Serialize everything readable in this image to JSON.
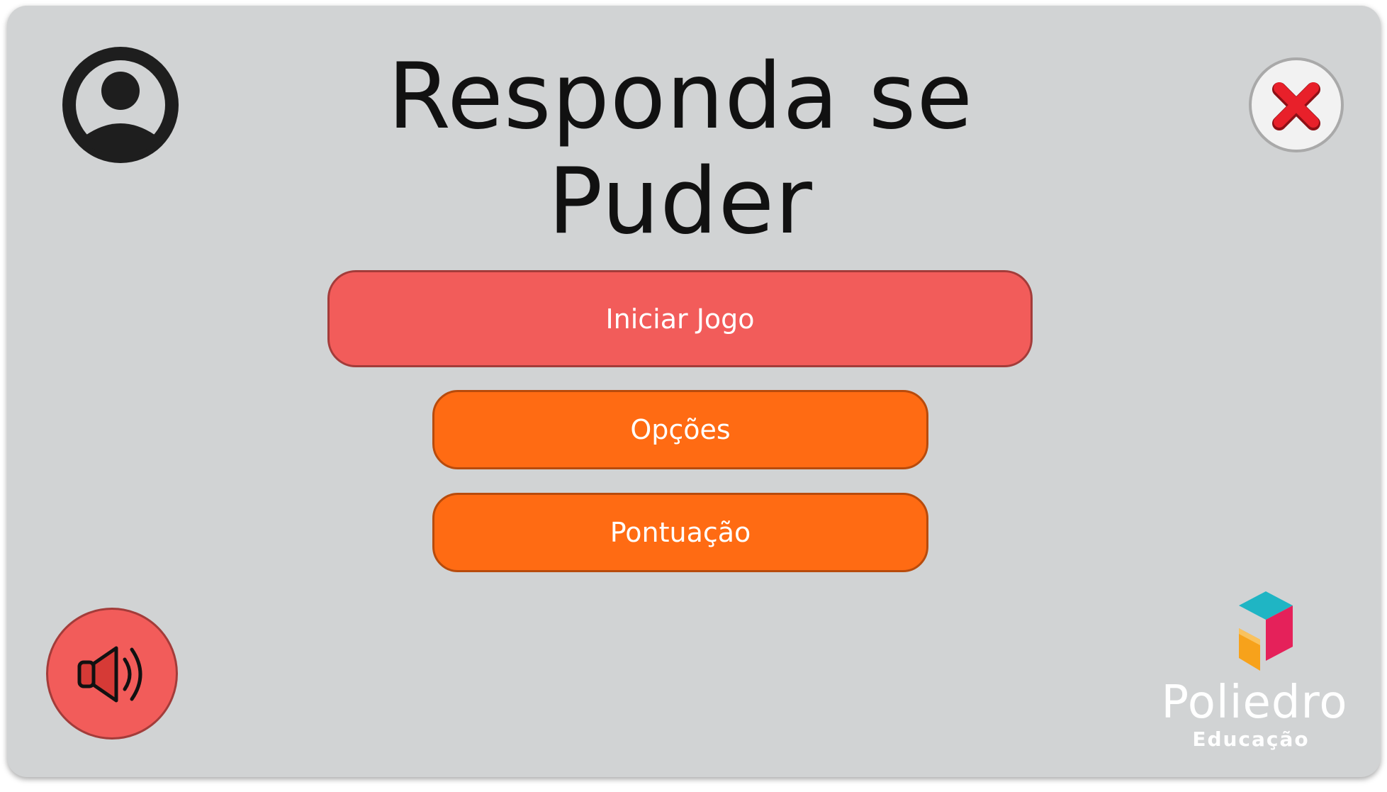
{
  "game": {
    "title_line1": "Responda se",
    "title_line2": "Puder"
  },
  "menu": {
    "start_label": "Iniciar Jogo",
    "options_label": "Opções",
    "score_label": "Pontuação"
  },
  "icons": {
    "profile": "user-circle-icon",
    "close": "red-x-icon",
    "sound": "speaker-volume-icon"
  },
  "brand": {
    "name": "Poliedro",
    "tagline": "Educação"
  },
  "colors": {
    "background": "#d1d3d4",
    "start_button": "#f25c5a",
    "secondary_buttons": "#ff6b13",
    "close_x": "#e8202a",
    "logo_cyan": "#1fb5c4",
    "logo_magenta": "#e5215a",
    "logo_orange": "#f7a21b"
  }
}
